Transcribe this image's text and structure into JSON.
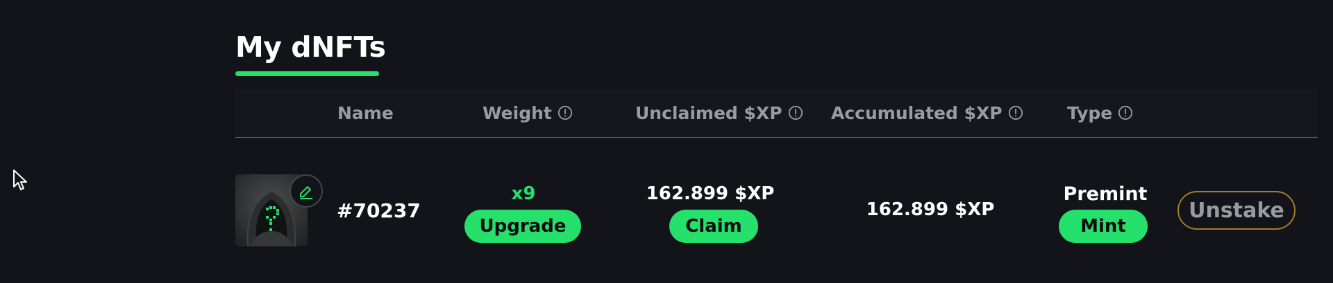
{
  "section": {
    "title": "My dNFTs"
  },
  "table": {
    "headers": {
      "name": "Name",
      "weight": "Weight",
      "unclaimed": "Unclaimed $XP",
      "accumulated": "Accumulated $XP",
      "type": "Type"
    },
    "rows": [
      {
        "name": "#70237",
        "weight": "x9",
        "upgrade_label": "Upgrade",
        "unclaimed": "162.899 $XP",
        "claim_label": "Claim",
        "accumulated": "162.899 $XP",
        "type": "Premint",
        "mint_label": "Mint",
        "unstake_label": "Unstake"
      }
    ]
  },
  "colors": {
    "background": "#131419",
    "accent_green": "#26e06c",
    "header_text": "#9a9b9f",
    "unstake_border": "#a57c26"
  },
  "icons": {
    "cursor": "mouse-pointer-icon",
    "info": "info-circle-icon",
    "edit": "edit-pencil-icon"
  }
}
